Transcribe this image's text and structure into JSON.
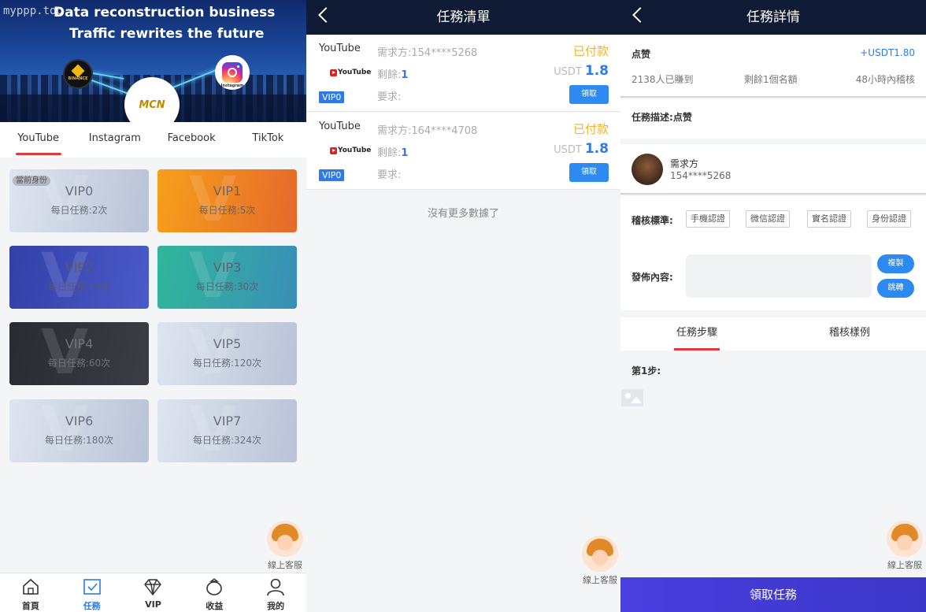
{
  "panel1": {
    "watermark": "myppp.top",
    "banner_line1": "Data reconstruction business",
    "banner_line2": "Traffic rewrites the future",
    "banner_logos": {
      "binance": "BINANCE",
      "mcn": "MCN",
      "instagram": "Instagram"
    },
    "tabs": [
      "YouTube",
      "Instagram",
      "Facebook",
      "TikTok"
    ],
    "active_tab": "YouTube",
    "current_tag": "當前身份",
    "vip_cards": [
      {
        "name": "VIP0",
        "desc": "每日任務:2次"
      },
      {
        "name": "VIP1",
        "desc": "每日任務:5次"
      },
      {
        "name": "VIP2",
        "desc": "每日任務:15次"
      },
      {
        "name": "VIP3",
        "desc": "每日任務:30次"
      },
      {
        "name": "VIP4",
        "desc": "每日任務:60次"
      },
      {
        "name": "VIP5",
        "desc": "每日任務:120次"
      },
      {
        "name": "VIP6",
        "desc": "每日任務:180次"
      },
      {
        "name": "VIP7",
        "desc": "每日任務:324次"
      }
    ],
    "service_label": "線上客服",
    "nav": [
      {
        "label": "首頁",
        "icon": "home-icon"
      },
      {
        "label": "任務",
        "icon": "task-icon"
      },
      {
        "label": "VIP",
        "icon": "diamond-icon"
      },
      {
        "label": "收益",
        "icon": "moneybag-icon"
      },
      {
        "label": "我的",
        "icon": "user-icon"
      }
    ],
    "active_nav": "任務"
  },
  "panel2": {
    "title": "任務清單",
    "tasks": [
      {
        "platform": "YouTube",
        "logo": "YouTube",
        "vip": "VIP0",
        "requester": "需求方:154****5268",
        "remaining_label": "剩餘:",
        "remaining": "1",
        "requirement": "要求:",
        "status": "已付款",
        "currency": "USDT",
        "amount": "1.8",
        "button": "領取"
      },
      {
        "platform": "YouTube",
        "logo": "YouTube",
        "vip": "VIP0",
        "requester": "需求方:164****4708",
        "remaining_label": "剩餘:",
        "remaining": "1",
        "requirement": "要求:",
        "status": "已付款",
        "currency": "USDT",
        "amount": "1.8",
        "button": "領取"
      }
    ],
    "no_more": "沒有更多數據了",
    "service_label": "線上客服"
  },
  "panel3": {
    "title": "任務詳情",
    "task_name": "点赞",
    "reward": "+USDT1.80",
    "stats": [
      "2138人已賺到",
      "剩餘1個名額",
      "48小時內稽核"
    ],
    "desc_label": "任務描述:",
    "desc_value": "点赞",
    "requester_label": "需求方",
    "requester_value": "154****5268",
    "audit_label": "稽核標準:",
    "audit_chips": [
      "手機認證",
      "微信認證",
      "實名認證",
      "身份認證"
    ],
    "publish_label": "發佈內容:",
    "copy_button": "複製",
    "jump_button": "跳轉",
    "tabs": [
      "任務步驟",
      "稽核樣例"
    ],
    "active_tab": "任務步驟",
    "step_label": "第1步:",
    "service_label": "線上客服",
    "claim_button": "領取任務"
  },
  "colors": {
    "accent": "#2d7ae8",
    "header": "#0f1b35",
    "paid": "#f0b42a",
    "tab_underline": "#e23a3a",
    "claim": "#4a3ee0"
  }
}
